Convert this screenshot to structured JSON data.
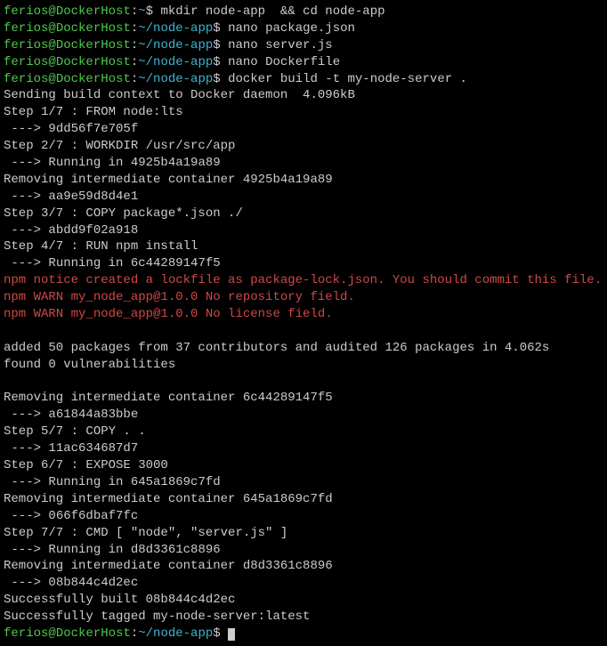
{
  "prompts": [
    {
      "user": "ferios",
      "host": "DockerHost",
      "path": "~",
      "cmd": "mkdir node-app  && cd node-app"
    },
    {
      "user": "ferios",
      "host": "DockerHost",
      "path": "~/node-app",
      "cmd": "nano package.json"
    },
    {
      "user": "ferios",
      "host": "DockerHost",
      "path": "~/node-app",
      "cmd": "nano server.js"
    },
    {
      "user": "ferios",
      "host": "DockerHost",
      "path": "~/node-app",
      "cmd": "nano Dockerfile"
    },
    {
      "user": "ferios",
      "host": "DockerHost",
      "path": "~/node-app",
      "cmd": "docker build -t my-node-server ."
    }
  ],
  "output": [
    "Sending build context to Docker daemon  4.096kB",
    "Step 1/7 : FROM node:lts",
    " ---> 9dd56f7e705f",
    "Step 2/7 : WORKDIR /usr/src/app",
    " ---> Running in 4925b4a19a89",
    "Removing intermediate container 4925b4a19a89",
    " ---> aa9e59d8d4e1",
    "Step 3/7 : COPY package*.json ./",
    " ---> abdd9f02a918",
    "Step 4/7 : RUN npm install",
    " ---> Running in 6c44289147f5"
  ],
  "npm_lines": [
    "npm notice created a lockfile as package-lock.json. You should commit this file.",
    "npm WARN my_node_app@1.0.0 No repository field.",
    "npm WARN my_node_app@1.0.0 No license field."
  ],
  "output2": [
    "",
    "added 50 packages from 37 contributors and audited 126 packages in 4.062s",
    "found 0 vulnerabilities",
    "",
    "Removing intermediate container 6c44289147f5",
    " ---> a61844a83bbe",
    "Step 5/7 : COPY . .",
    " ---> 11ac634687d7",
    "Step 6/7 : EXPOSE 3000",
    " ---> Running in 645a1869c7fd",
    "Removing intermediate container 645a1869c7fd",
    " ---> 066f6dbaf7fc",
    "Step 7/7 : CMD [ \"node\", \"server.js\" ]",
    " ---> Running in d8d3361c8896",
    "Removing intermediate container d8d3361c8896",
    " ---> 08b844c4d2ec",
    "Successfully built 08b844c4d2ec",
    "Successfully tagged my-node-server:latest"
  ],
  "final_prompt": {
    "user": "ferios",
    "host": "DockerHost",
    "path": "~/node-app",
    "cmd": ""
  }
}
